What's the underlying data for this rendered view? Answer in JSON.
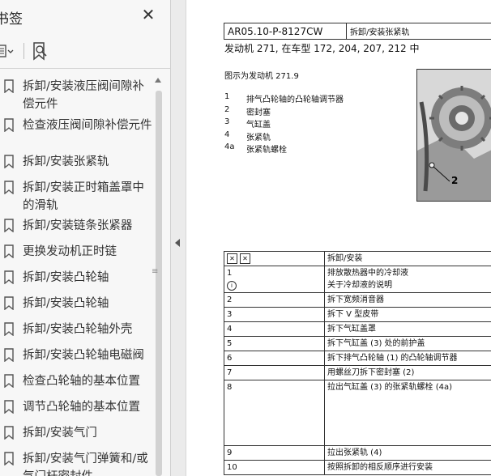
{
  "panel": {
    "title": "书签",
    "close_glyph": "✕",
    "bookmarks": [
      {
        "label": "拆卸/安装液压阀间隙补偿元件"
      },
      {
        "label": "检查液压阀间隙补偿元件"
      },
      {
        "label": "拆卸/安装张紧轨"
      },
      {
        "label": "拆卸/安装正时箱盖罩中的滑轨"
      },
      {
        "label": "拆卸/安装链条张紧器"
      },
      {
        "label": "更换发动机正时链"
      },
      {
        "label": "拆卸/安装凸轮轴"
      },
      {
        "label": "拆卸/安装凸轮轴"
      },
      {
        "label": "拆卸/安装凸轮轴外壳"
      },
      {
        "label": "拆卸/安装凸轮轴电磁阀"
      },
      {
        "label": "检查凸轮轴的基本位置"
      },
      {
        "label": "调节凸轮轴的基本位置"
      },
      {
        "label": "拆卸/安装气门"
      },
      {
        "label": "拆卸/安装气门弹簧和/或气门杆密封件"
      }
    ]
  },
  "document": {
    "doc_code": "AR05.10-P-8127CW",
    "doc_title": "拆卸/安装张紧轨",
    "engine_line": "发动机    271, 在车型 172, 204, 207, 212 中",
    "figure_caption": "图示为发动机 271.9",
    "figure_callout": "2",
    "legend": [
      {
        "num": "1",
        "text": "排气凸轮轴的凸轮轴调节器"
      },
      {
        "num": "2",
        "text": "密封塞"
      },
      {
        "num": "3",
        "text": "气缸盖"
      },
      {
        "num": "4",
        "text": "张紧轨"
      },
      {
        "num": "4a",
        "text": "张紧轨螺栓"
      }
    ],
    "steps_header": "拆卸/安装",
    "steps": [
      {
        "num": "1",
        "text": "排放散热器中的冷却液",
        "note": "关于冷却液的说明"
      },
      {
        "num": "2",
        "text": "拆下宽频消音器"
      },
      {
        "num": "3",
        "text": "拆下 V 型皮带"
      },
      {
        "num": "4",
        "text": "拆下气缸盖罩"
      },
      {
        "num": "5",
        "text": "拆下气缸盖 (3) 处的前护盖"
      },
      {
        "num": "6",
        "text": "拆下排气凸轮轴 (1) 的凸轮轴调节器"
      },
      {
        "num": "7",
        "text": "用螺丝刀拆下密封塞 (2)"
      },
      {
        "num": "8",
        "text": "拉出气缸盖 (3) 的张紧轨螺栓 (4a)"
      },
      {
        "num": "9",
        "text": "拉出张紧轨 (4)"
      },
      {
        "num": "10",
        "text": "按照拆卸的相反顺序进行安装"
      }
    ]
  }
}
